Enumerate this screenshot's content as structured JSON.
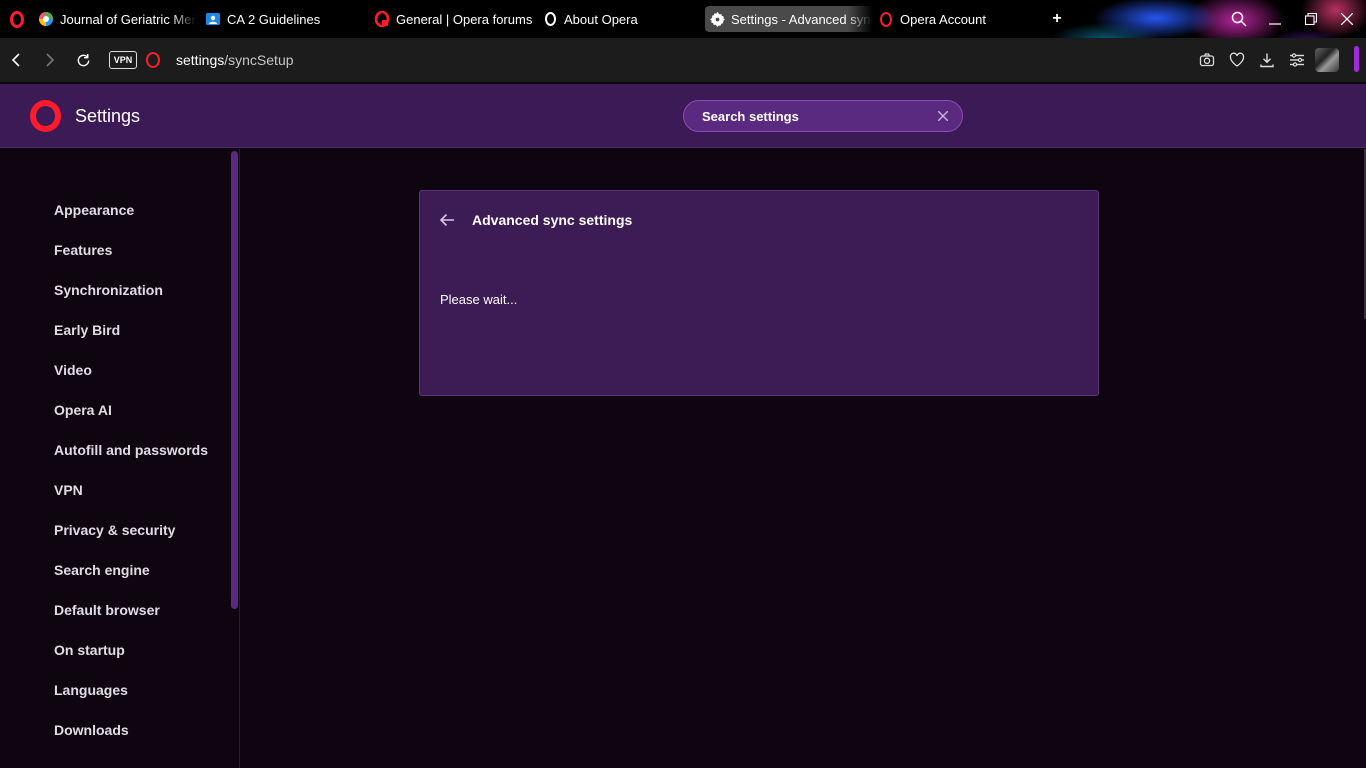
{
  "tabs": [
    {
      "label": "Journal of Geriatric Mental Health",
      "icon": "colorful-circle-icon",
      "active": false
    },
    {
      "label": "CA 2 Guidelines",
      "icon": "google-classroom-icon",
      "active": false
    },
    {
      "label": "General | Opera forums",
      "icon": "opera-forums-icon",
      "active": false
    },
    {
      "label": "About Opera",
      "icon": "opera-icon",
      "active": false
    },
    {
      "label": "Settings - Advanced sync settings",
      "icon": "gear-icon",
      "active": true
    },
    {
      "label": "Opera Account",
      "icon": "opera-icon",
      "active": false
    }
  ],
  "addressbar": {
    "vpn_label": "VPN",
    "url_host": "settings",
    "url_path": "/syncSetup"
  },
  "header": {
    "title": "Settings",
    "search_placeholder": "Search settings"
  },
  "nav": {
    "items": [
      "Appearance",
      "Features",
      "Synchronization",
      "Early Bird",
      "Video",
      "Opera AI",
      "Autofill and passwords",
      "VPN",
      "Privacy & security",
      "Search engine",
      "Default browser",
      "On startup",
      "Languages",
      "Downloads"
    ]
  },
  "card": {
    "title": "Advanced sync settings",
    "status": "Please wait..."
  },
  "colors": {
    "opera_red": "#ff1b2d",
    "header_bg": "#3c1a55",
    "card_bg": "#3d1c55",
    "page_bg": "#0f0510",
    "accent": "#a22bd8"
  }
}
